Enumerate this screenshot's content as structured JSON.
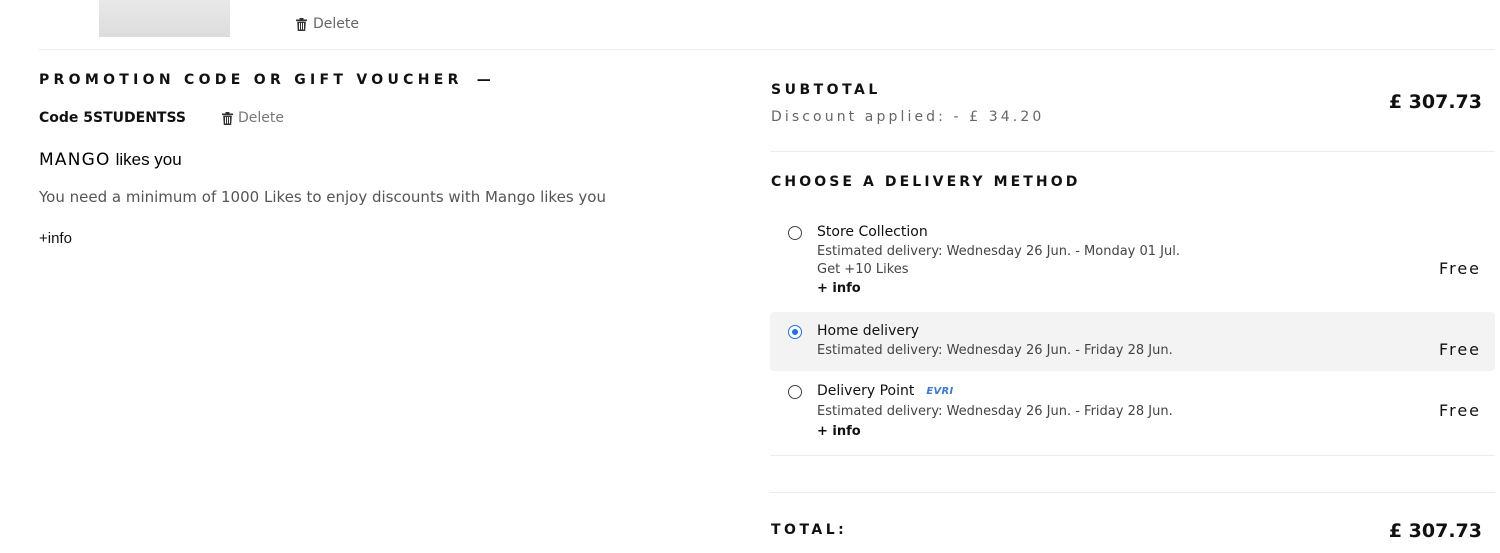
{
  "cart_item": {
    "delete_label": "Delete"
  },
  "promo": {
    "title": "PROMOTION CODE OR GIFT VOUCHER",
    "collapse_symbol": "—",
    "code_label": "Code 5STUDENTSS",
    "delete_label": "Delete"
  },
  "likes": {
    "brand": "MANGO",
    "suffix": "likes you",
    "info": "You need a minimum of 1000 Likes to enjoy discounts with Mango likes you",
    "more_info": "+info"
  },
  "summary": {
    "subtotal_label": "SUBTOTAL",
    "discount_text": "Discount applied: - £ 34.20",
    "subtotal_amount": "£ 307.73",
    "total_label": "TOTAL:",
    "total_amount": "£ 307.73"
  },
  "delivery": {
    "title": "CHOOSE A DELIVERY METHOD",
    "options": [
      {
        "name": "Store Collection",
        "estimate": "Estimated delivery: Wednesday 26 Jun. - Monday 01 Jul.",
        "extra": "Get +10 Likes",
        "more": "+ info",
        "price": "Free",
        "selected": false
      },
      {
        "name": "Home delivery",
        "estimate": "Estimated delivery: Wednesday 26 Jun. - Friday 28 Jun.",
        "price": "Free",
        "selected": true
      },
      {
        "name": "Delivery Point",
        "carrier": "EVRI",
        "estimate": "Estimated delivery: Wednesday 26 Jun. - Friday 28 Jun.",
        "more": "+ info",
        "price": "Free",
        "selected": false
      }
    ]
  },
  "colors": {
    "accent": "#1a73e8",
    "selected_bg": "#f3f3f3",
    "divider": "#ececec",
    "carrier_logo": "#3a7bd5"
  },
  "icons": {
    "delete": "trash-icon"
  }
}
